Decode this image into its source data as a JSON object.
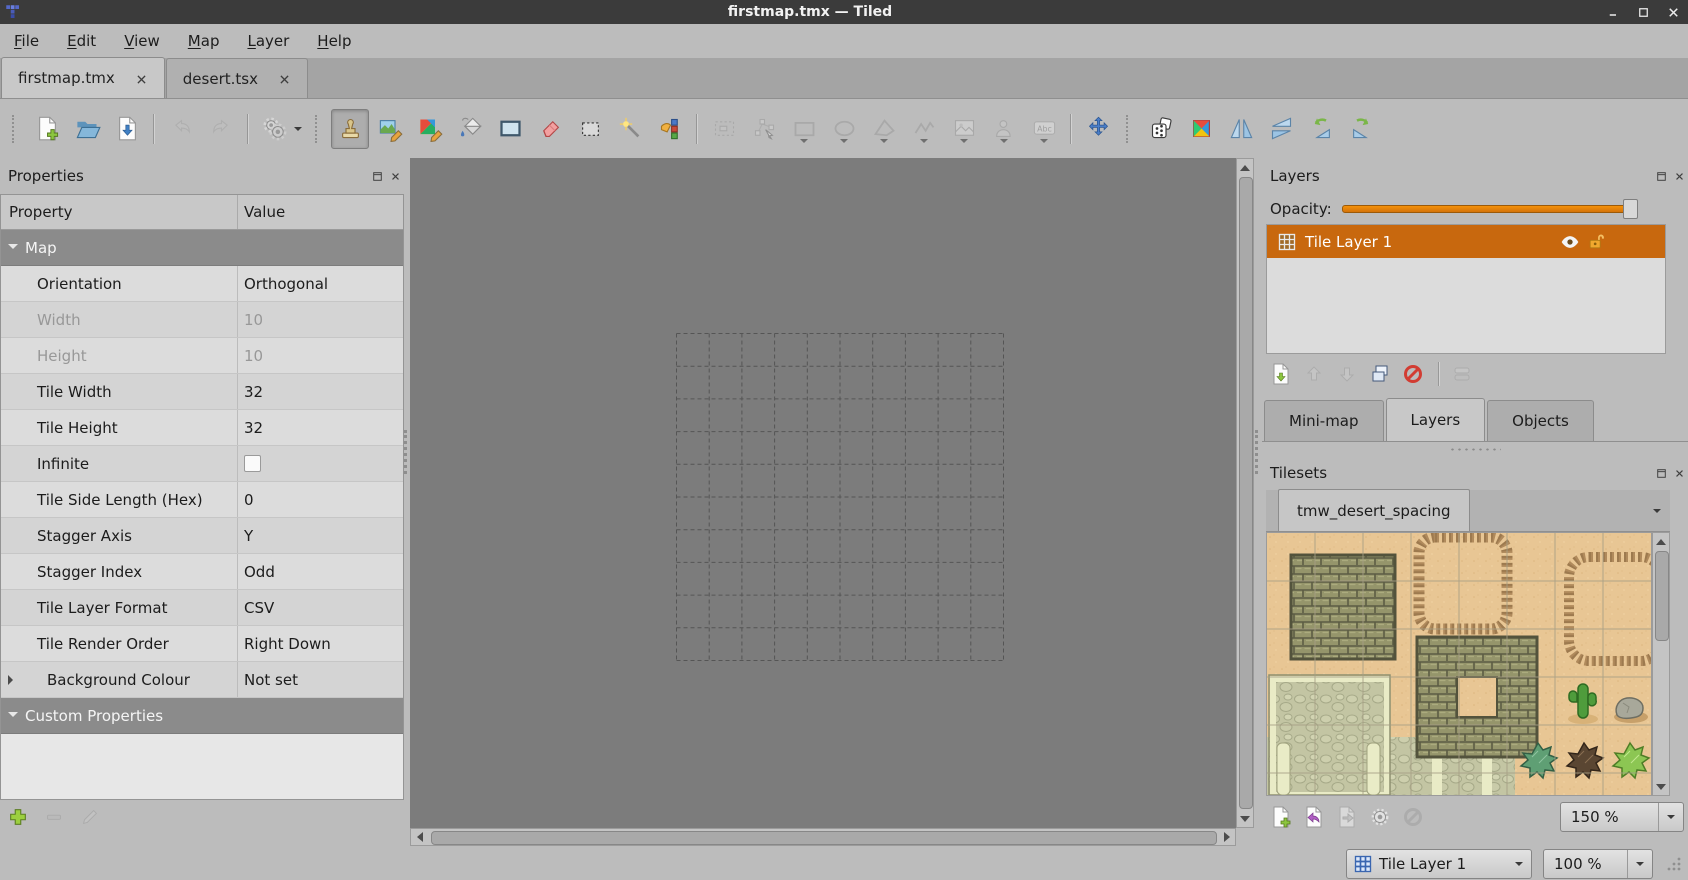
{
  "titlebar": {
    "title": "firstmap.tmx — Tiled"
  },
  "menubar": {
    "items": [
      "File",
      "Edit",
      "View",
      "Map",
      "Layer",
      "Help"
    ]
  },
  "document_tabs": [
    {
      "label": "firstmap.tmx",
      "active": true
    },
    {
      "label": "desert.tsx",
      "active": false
    }
  ],
  "toolbar": {
    "items": [
      {
        "type": "handle"
      },
      {
        "type": "button",
        "name": "new-map"
      },
      {
        "type": "button",
        "name": "open-file"
      },
      {
        "type": "button",
        "name": "save-file"
      },
      {
        "type": "sep"
      },
      {
        "type": "button",
        "name": "undo",
        "disabled": true
      },
      {
        "type": "button",
        "name": "redo",
        "disabled": true
      },
      {
        "type": "sep"
      },
      {
        "type": "button",
        "name": "execute-command",
        "dropdown": "right"
      },
      {
        "type": "handle"
      },
      {
        "type": "button",
        "name": "stamp-brush",
        "active": true
      },
      {
        "type": "button",
        "name": "terrain-brush"
      },
      {
        "type": "button",
        "name": "wang-brush"
      },
      {
        "type": "button",
        "name": "bucket-fill"
      },
      {
        "type": "button",
        "name": "shape-fill"
      },
      {
        "type": "button",
        "name": "eraser"
      },
      {
        "type": "button",
        "name": "rectangular-select"
      },
      {
        "type": "button",
        "name": "magic-wand"
      },
      {
        "type": "button",
        "name": "same-tile-select"
      },
      {
        "type": "sep"
      },
      {
        "type": "button",
        "name": "select-objects",
        "disabled": true
      },
      {
        "type": "button",
        "name": "edit-polygons",
        "disabled": true
      },
      {
        "type": "button",
        "name": "insert-rectangle",
        "disabled": true,
        "dropdown": "below"
      },
      {
        "type": "button",
        "name": "insert-ellipse",
        "disabled": true,
        "dropdown": "below"
      },
      {
        "type": "button",
        "name": "insert-polygon",
        "disabled": true,
        "dropdown": "below"
      },
      {
        "type": "button",
        "name": "insert-polyline",
        "disabled": true,
        "dropdown": "below"
      },
      {
        "type": "button",
        "name": "insert-tile",
        "disabled": true,
        "dropdown": "below"
      },
      {
        "type": "button",
        "name": "insert-template",
        "disabled": true,
        "dropdown": "below"
      },
      {
        "type": "button",
        "name": "insert-text",
        "disabled": true,
        "dropdown": "below"
      },
      {
        "type": "sep"
      },
      {
        "type": "button",
        "name": "offset-layers"
      },
      {
        "type": "handle"
      },
      {
        "type": "button",
        "name": "random-mode"
      },
      {
        "type": "button",
        "name": "wang-fill-mode"
      },
      {
        "type": "button",
        "name": "flip-horizontal"
      },
      {
        "type": "button",
        "name": "flip-vertical"
      },
      {
        "type": "button",
        "name": "rotate-left"
      },
      {
        "type": "button",
        "name": "rotate-right"
      }
    ]
  },
  "properties": {
    "title": "Properties",
    "columns": [
      "Property",
      "Value"
    ],
    "rows": [
      {
        "type": "group",
        "label": "Map"
      },
      {
        "type": "prop",
        "label": "Orientation",
        "value": "Orthogonal"
      },
      {
        "type": "prop",
        "label": "Width",
        "value": "10",
        "disabled": true
      },
      {
        "type": "prop",
        "label": "Height",
        "value": "10",
        "disabled": true
      },
      {
        "type": "prop",
        "label": "Tile Width",
        "value": "32"
      },
      {
        "type": "prop",
        "label": "Tile Height",
        "value": "32"
      },
      {
        "type": "prop",
        "label": "Infinite",
        "value": "",
        "control": "checkbox",
        "checked": false
      },
      {
        "type": "prop",
        "label": "Tile Side Length (Hex)",
        "value": "0"
      },
      {
        "type": "prop",
        "label": "Stagger Axis",
        "value": "Y"
      },
      {
        "type": "prop",
        "label": "Stagger Index",
        "value": "Odd"
      },
      {
        "type": "prop",
        "label": "Tile Layer Format",
        "value": "CSV"
      },
      {
        "type": "prop",
        "label": "Tile Render Order",
        "value": "Right Down"
      },
      {
        "type": "prop",
        "label": "Background Colour",
        "value": "Not set",
        "expander": true
      },
      {
        "type": "group",
        "label": "Custom Properties"
      }
    ],
    "footer_buttons": [
      {
        "name": "add-property"
      },
      {
        "name": "remove-property",
        "disabled": true
      },
      {
        "name": "edit-property",
        "disabled": true
      }
    ]
  },
  "layers_panel": {
    "title": "Layers",
    "opacity_label": "Opacity:",
    "opacity_percent": 100,
    "layers": [
      {
        "name": "Tile Layer 1",
        "type": "tile-layer",
        "selected": true,
        "visible": true,
        "locked": false
      }
    ],
    "buttons": [
      {
        "name": "new-layer"
      },
      {
        "name": "raise-layer",
        "disabled": true
      },
      {
        "name": "lower-layer",
        "disabled": true
      },
      {
        "name": "duplicate-layer"
      },
      {
        "name": "remove-layer"
      },
      {
        "type": "sep"
      },
      {
        "name": "toggle-other-layers",
        "disabled": true
      }
    ],
    "tabs": [
      {
        "label": "Mini-map",
        "active": false
      },
      {
        "label": "Layers",
        "active": true
      },
      {
        "label": "Objects",
        "active": false
      }
    ]
  },
  "tilesets_panel": {
    "title": "Tilesets",
    "tabs": [
      {
        "label": "tmw_desert_spacing",
        "active": true
      }
    ],
    "buttons": [
      {
        "name": "new-tileset"
      },
      {
        "name": "embed-tileset"
      },
      {
        "name": "export-tileset",
        "disabled": true
      },
      {
        "name": "tileset-properties"
      },
      {
        "name": "remove-tileset",
        "disabled": true
      }
    ],
    "zoom_value": "150 %"
  },
  "statusbar": {
    "layer_selector": "Tile Layer 1",
    "zoom": "100 %"
  },
  "map_view": {
    "grid_cols": 10,
    "grid_rows": 10,
    "grid_size_px": 327
  },
  "colors": {
    "selection_orange": "#c8680e",
    "canvas_bg": "#7c7c7c",
    "sand": "#e8c694",
    "titlebar": "#3b3b3b"
  }
}
